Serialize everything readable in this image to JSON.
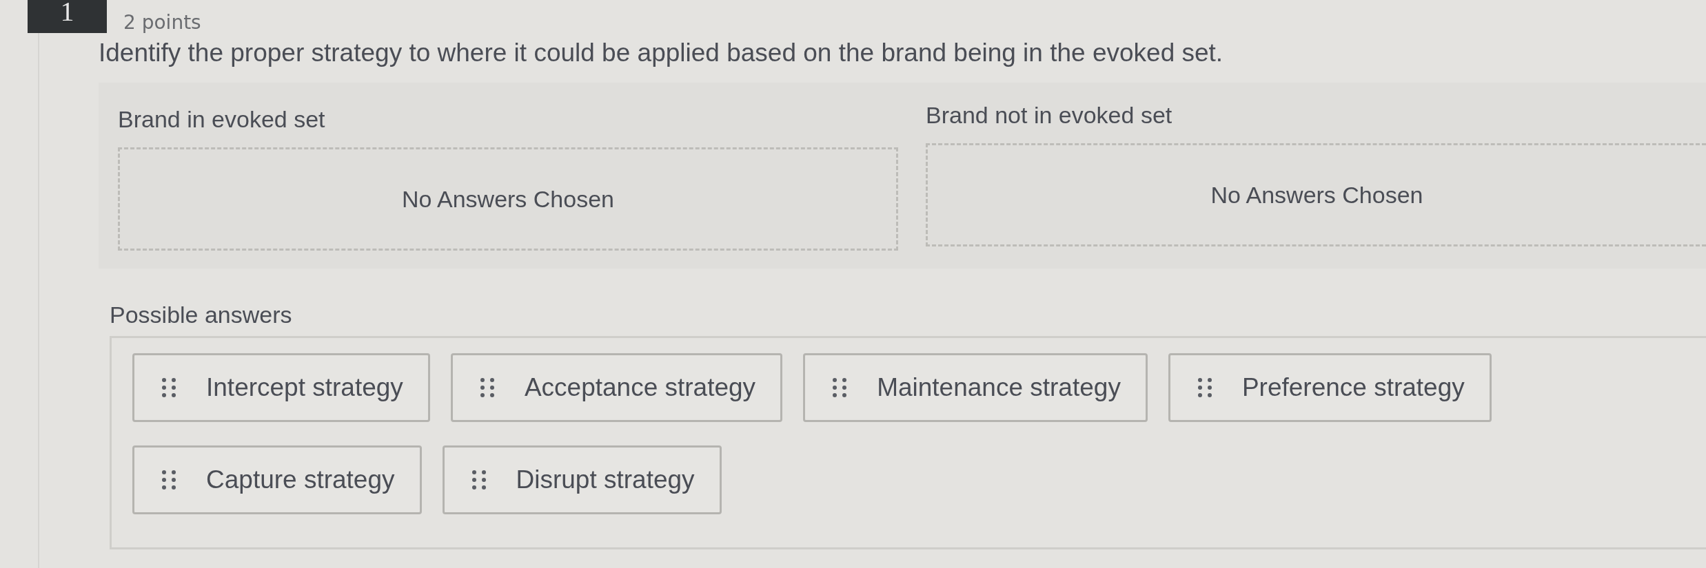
{
  "question": {
    "number": "1",
    "points": "2 points",
    "prompt": "Identify the proper strategy to where it could be applied based on the brand being in the evoked set."
  },
  "drop_zones": [
    {
      "label": "Brand in evoked set",
      "empty_text": "No Answers Chosen"
    },
    {
      "label": "Brand not in evoked set",
      "empty_text": "No Answers Chosen"
    }
  ],
  "possible_answers": {
    "label": "Possible answers",
    "items": [
      [
        "Intercept strategy",
        "Acceptance strategy",
        "Maintenance strategy",
        "Preference strategy"
      ],
      [
        "Capture strategy",
        "Disrupt strategy"
      ]
    ]
  }
}
